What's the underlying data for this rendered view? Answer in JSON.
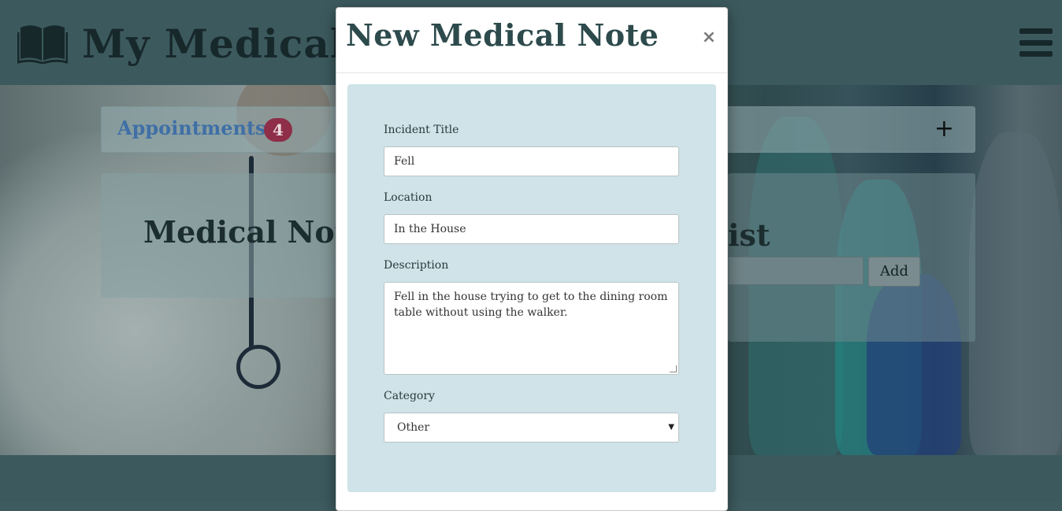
{
  "navbar": {
    "brand_title": "My Medical",
    "brand_icon": "book-icon",
    "menu_icon": "hamburger-icon"
  },
  "appointments": {
    "label": "Appointments",
    "count": "4",
    "add_label": "+"
  },
  "notes_panel": {
    "title": "Medical Note"
  },
  "list_panel": {
    "title_fragment": "ist",
    "add_label": "Add"
  },
  "modal": {
    "title": "New Medical Note",
    "close_label": "×",
    "fields": {
      "incident_title": {
        "label": "Incident Title",
        "value": "Fell"
      },
      "location": {
        "label": "Location",
        "value": "In the House"
      },
      "description": {
        "label": "Description",
        "value": "Fell in the house trying to get to the dining room table without using the walker."
      },
      "category": {
        "label": "Category",
        "value": "Other"
      }
    }
  },
  "colors": {
    "navbar": "#3c5a5e",
    "modal_well": "#cfe3e8",
    "badge": "#8e2e48",
    "appointments_link": "#3f6fa6"
  }
}
